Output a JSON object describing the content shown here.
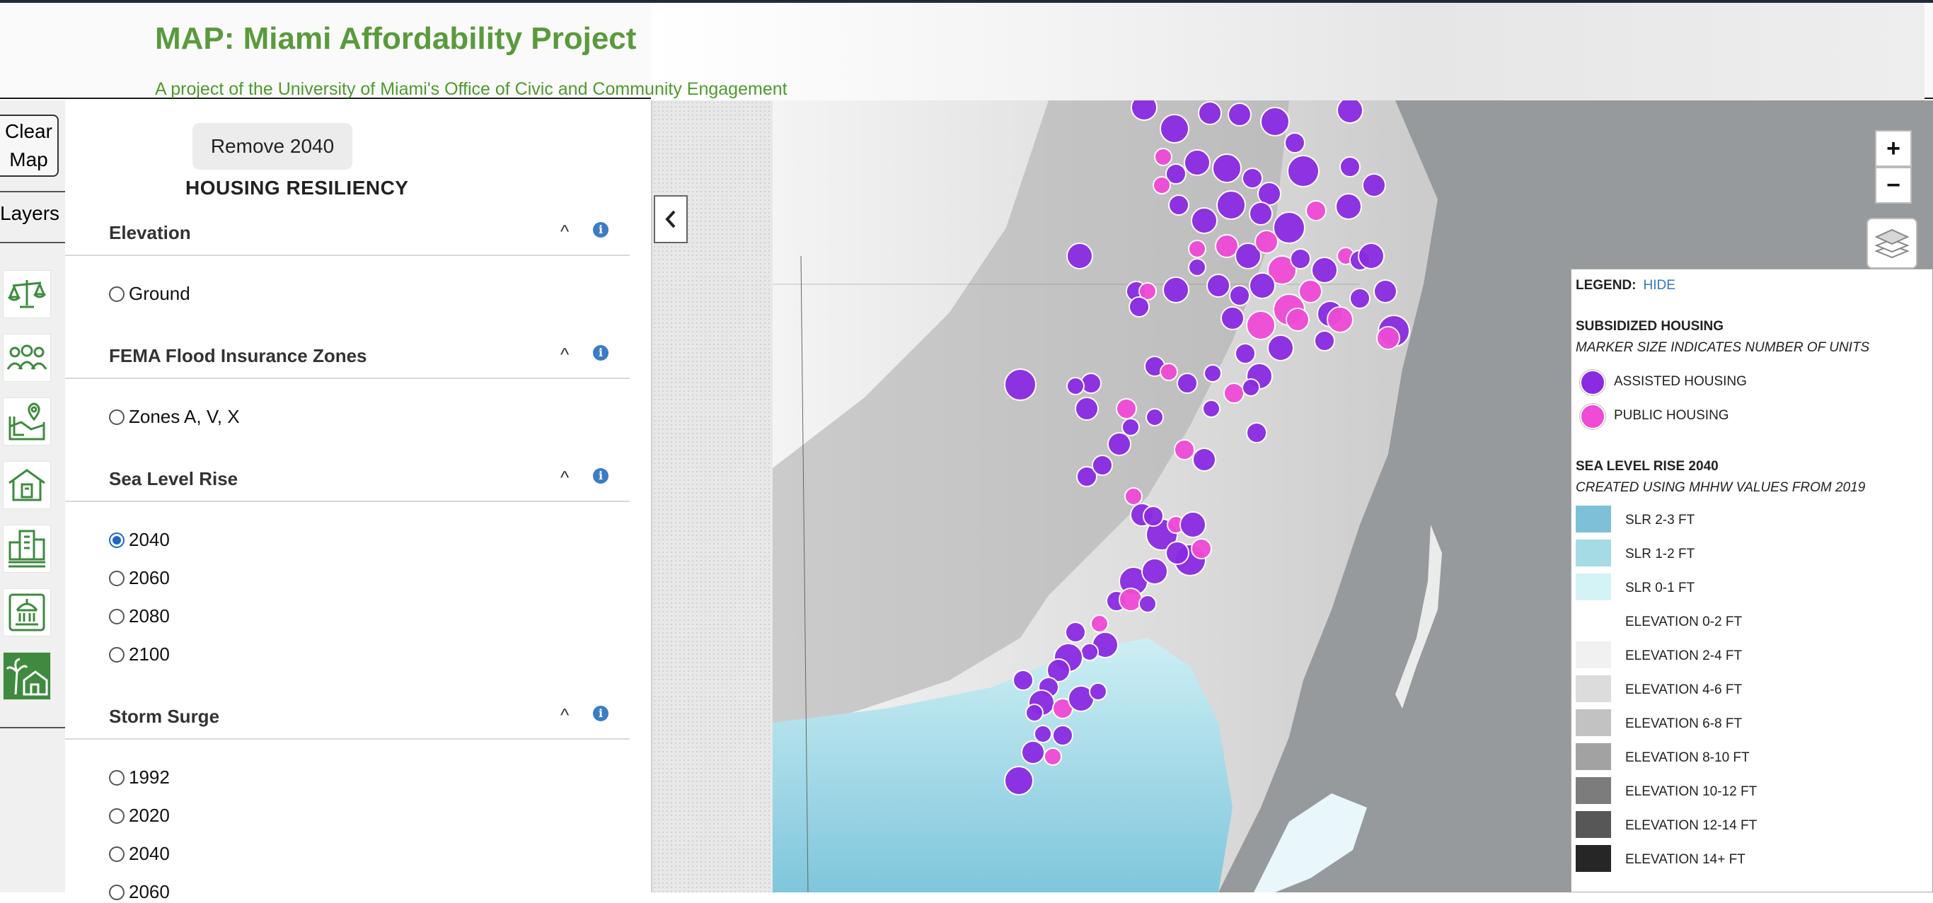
{
  "header": {
    "title": "MAP: Miami Affordability Project",
    "subtitle": "A project of the University of Miami's Office of Civic and Community Engagement"
  },
  "sidebar": {
    "clear_line1": "Clear",
    "clear_line2": "Map",
    "layers_label": "Layers",
    "icons": [
      "balance-scale-icon",
      "people-group-icon",
      "map-pin-icon",
      "housing-icon",
      "city-buildings-icon",
      "government-building-icon",
      "palm-house-icon"
    ]
  },
  "panel": {
    "remove_button": "Remove 2040",
    "section_title": "HOUSING RESILIENCY",
    "groups": [
      {
        "title": "Elevation",
        "options": [
          {
            "label": "Ground",
            "checked": false
          }
        ]
      },
      {
        "title": "FEMA Flood Insurance Zones",
        "options": [
          {
            "label": "Zones A, V, X",
            "checked": false
          }
        ]
      },
      {
        "title": "Sea Level Rise",
        "options": [
          {
            "label": "2040",
            "checked": true
          },
          {
            "label": "2060",
            "checked": false
          },
          {
            "label": "2080",
            "checked": false
          },
          {
            "label": "2100",
            "checked": false
          }
        ]
      },
      {
        "title": "Storm Surge",
        "options": [
          {
            "label": "1992",
            "checked": false
          },
          {
            "label": "2020",
            "checked": false
          },
          {
            "label": "2040",
            "checked": false
          },
          {
            "label": "2060",
            "checked": false
          }
        ]
      }
    ],
    "caret": "^",
    "info": "i"
  },
  "map_controls": {
    "zoom_in": "+",
    "zoom_out": "−",
    "collapse_icon": "chevron-left-icon",
    "layers_icon": "layers-stack-icon"
  },
  "legend": {
    "label": "LEGEND:",
    "hide": "HIDE",
    "subsidized_title": "SUBSIDIZED HOUSING",
    "subsidized_note": "MARKER SIZE INDICATES NUMBER OF UNITS",
    "markers": [
      {
        "label": "ASSISTED HOUSING",
        "color": "#8a2be2"
      },
      {
        "label": "PUBLIC HOUSING",
        "color": "#f04ad6"
      }
    ],
    "slr_title": "SEA LEVEL RISE 2040",
    "slr_note": "CREATED USING MHHW VALUES FROM 2019",
    "swatches": [
      {
        "label": "SLR 2-3 FT",
        "color": "#7ec0d8"
      },
      {
        "label": "SLR 1-2 FT",
        "color": "#a5dbe5"
      },
      {
        "label": "SLR 0-1 FT",
        "color": "#d4f3f7"
      },
      {
        "label": "ELEVATION 0-2 FT",
        "color": "#ffffff"
      },
      {
        "label": "ELEVATION 2-4 FT",
        "color": "#f1f1f1"
      },
      {
        "label": "ELEVATION 4-6 FT",
        "color": "#dcdcdc"
      },
      {
        "label": "ELEVATION 6-8 FT",
        "color": "#c2c2c2"
      },
      {
        "label": "ELEVATION 8-10 FT",
        "color": "#a2a2a2"
      },
      {
        "label": "ELEVATION 10-12 FT",
        "color": "#7c7c7c"
      },
      {
        "label": "ELEVATION 12-14 FT",
        "color": "#575757"
      },
      {
        "label": "ELEVATION 14+ FT",
        "color": "#262626"
      }
    ]
  }
}
